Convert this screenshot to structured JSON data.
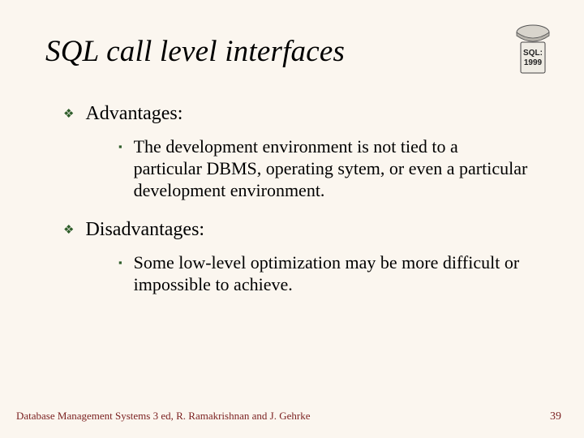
{
  "title": "SQL call level interfaces",
  "sections": {
    "adv": {
      "label": "Advantages:",
      "items": {
        "0": "The development environment is not tied to a particular DBMS, operating sytem, or even a particular development environment."
      }
    },
    "dis": {
      "label": "Disadvantages:",
      "items": {
        "0": "Some low-level optimization may be more difficult or impossible to achieve."
      }
    }
  },
  "footer": {
    "left": "Database Management Systems 3 ed, R. Ramakrishnan and J. Gehrke",
    "right": "39"
  },
  "badge": {
    "label": "SQL: 1999"
  }
}
